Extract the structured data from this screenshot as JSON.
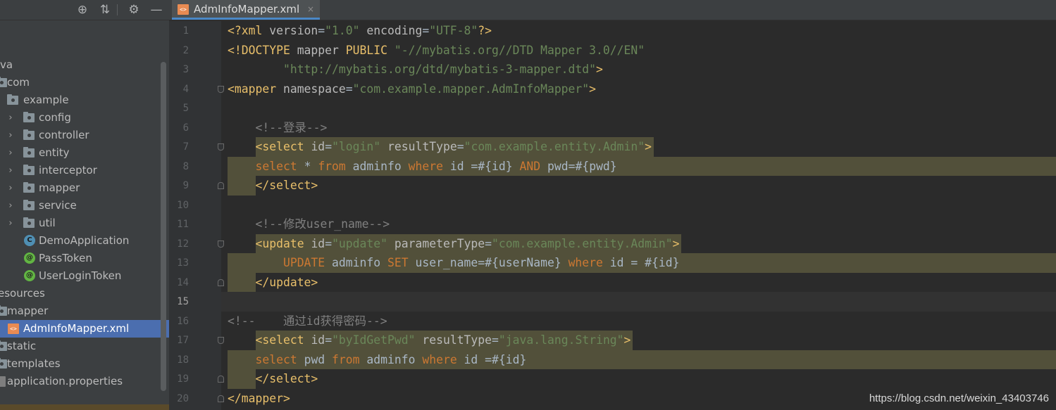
{
  "project_toolbar": {
    "icons": [
      "target-icon",
      "collapse-icon",
      "gear-icon",
      "minimize-icon"
    ]
  },
  "tree": [
    {
      "label": "va",
      "type": "partial"
    },
    {
      "label": "com",
      "type": "package"
    },
    {
      "label": "example",
      "type": "package"
    },
    {
      "label": "config",
      "type": "package"
    },
    {
      "label": "controller",
      "type": "package"
    },
    {
      "label": "entity",
      "type": "package"
    },
    {
      "label": "interceptor",
      "type": "package"
    },
    {
      "label": "mapper",
      "type": "package"
    },
    {
      "label": "service",
      "type": "package"
    },
    {
      "label": "util",
      "type": "package"
    },
    {
      "label": "DemoApplication",
      "type": "springboot-class"
    },
    {
      "label": "PassToken",
      "type": "annotation"
    },
    {
      "label": "UserLoginToken",
      "type": "annotation"
    },
    {
      "label": "esources",
      "type": "partial"
    },
    {
      "label": "mapper",
      "type": "folder"
    },
    {
      "label": "AdmInfoMapper.xml",
      "type": "xml-file"
    },
    {
      "label": "static",
      "type": "folder"
    },
    {
      "label": "templates",
      "type": "folder"
    },
    {
      "label": "application.properties",
      "type": "properties-file"
    }
  ],
  "editor": {
    "tab": {
      "label": "AdmInfoMapper.xml",
      "close": "×",
      "icon_text": "<>"
    },
    "current_line": 15,
    "code": [
      {
        "n": "1",
        "parts": [
          [
            "tag",
            "<?xml "
          ],
          [
            "attr",
            "version"
          ],
          [
            "txt",
            "="
          ],
          [
            "str",
            "\"1.0\""
          ],
          [
            "attr",
            " encoding"
          ],
          [
            "txt",
            "="
          ],
          [
            "str",
            "\"UTF-8\""
          ],
          [
            "tag",
            "?>"
          ]
        ]
      },
      {
        "n": "2",
        "parts": [
          [
            "tag",
            "<!DOCTYPE "
          ],
          [
            "attr",
            "mapper "
          ],
          [
            "tag",
            "PUBLIC "
          ],
          [
            "str",
            "\"-//mybatis.org//DTD Mapper 3.0//EN\""
          ]
        ]
      },
      {
        "n": "3",
        "parts": [
          [
            "txt",
            "        "
          ],
          [
            "str",
            "\"http://mybatis.org/dtd/mybatis-3-mapper.dtd\""
          ],
          [
            "tag",
            ">"
          ]
        ]
      },
      {
        "n": "4",
        "parts": [
          [
            "tag",
            "<mapper "
          ],
          [
            "attr",
            "namespace"
          ],
          [
            "txt",
            "="
          ],
          [
            "str",
            "\"com.example.mapper.AdmInfoMapper\""
          ],
          [
            "tag",
            ">"
          ]
        ]
      },
      {
        "n": "5",
        "parts": []
      },
      {
        "n": "6",
        "parts": [
          [
            "txt",
            "    "
          ],
          [
            "cmt",
            "<!--登录-->"
          ]
        ]
      },
      {
        "n": "7",
        "parts": [
          [
            "txt",
            "    "
          ],
          [
            "tag",
            "<select "
          ],
          [
            "attr",
            "id"
          ],
          [
            "txt",
            "="
          ],
          [
            "str",
            "\"login\""
          ],
          [
            "attr",
            " resultType"
          ],
          [
            "txt",
            "="
          ],
          [
            "str",
            "\"com.example.entity.Admin\""
          ],
          [
            "tag",
            ">"
          ]
        ]
      },
      {
        "n": "8",
        "parts": [
          [
            "txt",
            "    "
          ],
          [
            "kw",
            "select"
          ],
          [
            "txt",
            " * "
          ],
          [
            "kw",
            "from"
          ],
          [
            "txt",
            " adminfo "
          ],
          [
            "kw",
            "where"
          ],
          [
            "txt",
            " id =#{id} "
          ],
          [
            "kw",
            "AND"
          ],
          [
            "txt",
            " pwd=#{pwd}"
          ]
        ]
      },
      {
        "n": "9",
        "parts": [
          [
            "txt",
            "    "
          ],
          [
            "tag",
            "</select>"
          ]
        ]
      },
      {
        "n": "10",
        "parts": []
      },
      {
        "n": "11",
        "parts": [
          [
            "txt",
            "    "
          ],
          [
            "cmt",
            "<!--修改user_name-->"
          ]
        ]
      },
      {
        "n": "12",
        "parts": [
          [
            "txt",
            "    "
          ],
          [
            "tag",
            "<update "
          ],
          [
            "attr",
            "id"
          ],
          [
            "txt",
            "="
          ],
          [
            "str",
            "\"update\""
          ],
          [
            "attr",
            " parameterType"
          ],
          [
            "txt",
            "="
          ],
          [
            "str",
            "\"com.example.entity.Admin\""
          ],
          [
            "tag",
            ">"
          ]
        ]
      },
      {
        "n": "13",
        "parts": [
          [
            "txt",
            "        "
          ],
          [
            "kw",
            "UPDATE"
          ],
          [
            "txt",
            " adminfo "
          ],
          [
            "kw",
            "SET"
          ],
          [
            "txt",
            " user_name=#{userName} "
          ],
          [
            "kw",
            "where"
          ],
          [
            "txt",
            " id = #{id}"
          ]
        ]
      },
      {
        "n": "14",
        "parts": [
          [
            "txt",
            "    "
          ],
          [
            "tag",
            "</update>"
          ]
        ]
      },
      {
        "n": "15",
        "parts": []
      },
      {
        "n": "16",
        "parts": [
          [
            "cmt",
            "<!--    通过id获得密码-->"
          ]
        ]
      },
      {
        "n": "17",
        "parts": [
          [
            "txt",
            "    "
          ],
          [
            "tag",
            "<select "
          ],
          [
            "attr",
            "id"
          ],
          [
            "txt",
            "="
          ],
          [
            "str",
            "\"byIdGetPwd\""
          ],
          [
            "attr",
            " resultType"
          ],
          [
            "txt",
            "="
          ],
          [
            "str",
            "\"java.lang.String\""
          ],
          [
            "tag",
            ">"
          ]
        ]
      },
      {
        "n": "18",
        "parts": [
          [
            "txt",
            "    "
          ],
          [
            "kw",
            "select"
          ],
          [
            "txt",
            " pwd "
          ],
          [
            "kw",
            "from"
          ],
          [
            "txt",
            " adminfo "
          ],
          [
            "kw",
            "where"
          ],
          [
            "txt",
            " id =#{id}"
          ]
        ]
      },
      {
        "n": "19",
        "parts": [
          [
            "txt",
            "    "
          ],
          [
            "tag",
            "</select>"
          ]
        ]
      },
      {
        "n": "20",
        "parts": [
          [
            "tag",
            "</mapper>"
          ]
        ]
      }
    ]
  },
  "watermark": "https://blog.csdn.net/weixin_43403746",
  "colors": {
    "tag": "#e8bf6a",
    "attr": "#bababa",
    "string": "#6a8759",
    "keyword": "#cc7832",
    "comment": "#808080",
    "selection": "#4b6eaf",
    "sql_highlight": "#52503a"
  }
}
